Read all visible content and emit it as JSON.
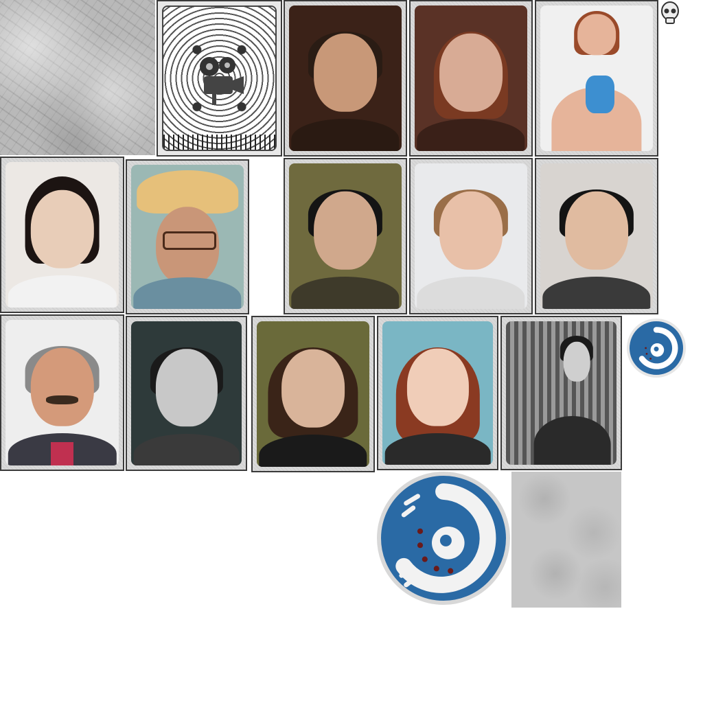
{
  "sheet": {
    "textures": [
      {
        "name": "paper-texture-tile"
      },
      {
        "name": "concrete-texture-tile"
      }
    ],
    "badge_color": "#2a6aa5",
    "frame_color": "#3a3a3a",
    "portraits": [
      {
        "id": "portrait-young-man-beard",
        "skin": "#c89878",
        "hair": "#2a1c14",
        "bg": "#3b2218",
        "clothes": "#2a1a12"
      },
      {
        "id": "portrait-woman-auburn",
        "skin": "#d8ab95",
        "hair": "#7a3a22",
        "bg": "#5a3226",
        "clothes": "#3a2018"
      },
      {
        "id": "portrait-woman-blue-swimsuit",
        "skin": "#e6b49a",
        "hair": "#9a4a2a",
        "bg": "#f0f0f0",
        "clothes": "#3d8fd0"
      },
      {
        "id": "portrait-woman-dark-bob",
        "skin": "#e8cdb8",
        "hair": "#1c1412",
        "bg": "#ece8e4",
        "clothes": "#f2f2f2"
      },
      {
        "id": "portrait-woman-glasses-hat",
        "skin": "#c99678",
        "hair": "#e6c07a",
        "bg": "#9bb8b4",
        "clothes": "#6a8fa0"
      },
      {
        "id": "portrait-man-dark-hair",
        "skin": "#d0a88c",
        "hair": "#141414",
        "bg": "#6f6a3e",
        "clothes": "#3e3a2a"
      },
      {
        "id": "portrait-woman-short-hair",
        "skin": "#e8c0a8",
        "hair": "#9a6e48",
        "bg": "#e9eaec",
        "clothes": "#dcdcdc"
      },
      {
        "id": "portrait-young-man-black-hair",
        "skin": "#e0bba0",
        "hair": "#141414",
        "bg": "#d8d4d0",
        "clothes": "#3a3a3a"
      },
      {
        "id": "portrait-older-man-mustache",
        "skin": "#d49a7a",
        "hair": "#8a8a8a",
        "bg": "#eeeeee",
        "clothes": "#c03050"
      },
      {
        "id": "portrait-vintage-man-bw",
        "skin": "#c8c8c8",
        "hair": "#1a1a1a",
        "bg": "#2e3a3a",
        "clothes": "#3a3a3a"
      },
      {
        "id": "portrait-woman-curly-smile",
        "skin": "#d9b49a",
        "hair": "#3a2418",
        "bg": "#6a6a3a",
        "clothes": "#1a1a1a"
      },
      {
        "id": "portrait-woman-red-hair",
        "skin": "#f0cdb8",
        "hair": "#8a3a22",
        "bg": "#7ab6c4",
        "clothes": "#2a2a2a"
      },
      {
        "id": "portrait-vintage-man-library",
        "skin": "#cfcfcf",
        "hair": "#1a1a1a",
        "bg": "#7a7a7a",
        "clothes": "#2a2a2a"
      }
    ]
  }
}
